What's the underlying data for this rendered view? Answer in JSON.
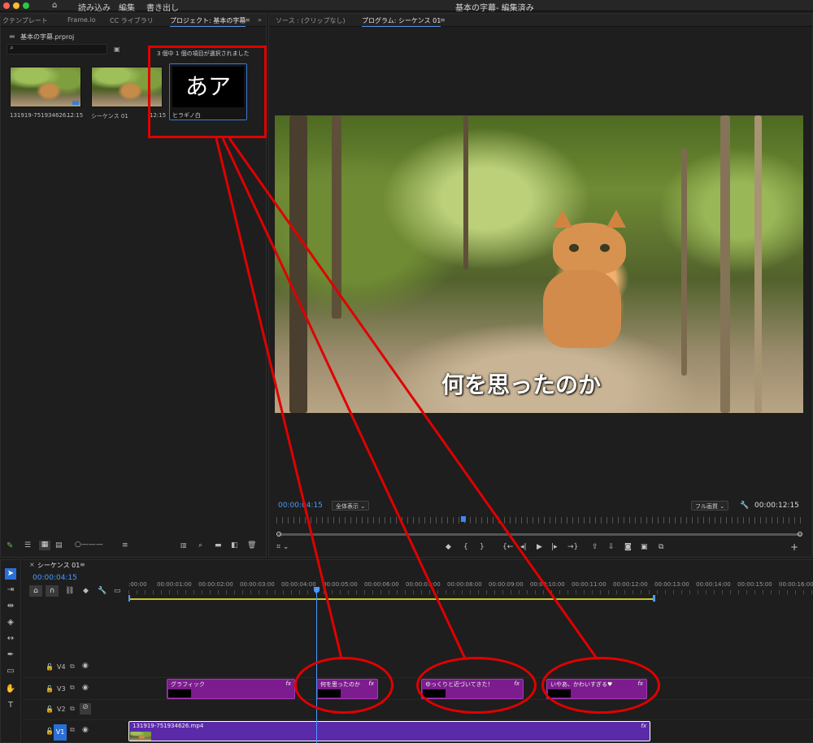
{
  "window": {
    "title": "基本の字幕- 編集済み",
    "menu": {
      "import": "読み込み",
      "edit": "編集",
      "export": "書き出し"
    }
  },
  "project_panel": {
    "tabs": [
      "クテンプレート",
      "Frame.io",
      "CC ライブラリ",
      "プロジェクト: 基本の字幕"
    ],
    "project_file": "基本の字幕.prproj",
    "selection_text": "3 個中 1 個の項目が選択されました",
    "items": [
      {
        "name": "131919-751934626...",
        "duration": "12:15"
      },
      {
        "name": "シーケンス 01",
        "duration": "12:15"
      },
      {
        "name": "ヒラギノ白",
        "preview_text": "あア"
      }
    ]
  },
  "source_tab": "ソース : (クリップなし)",
  "program_tab": "プログラム: シーケンス 01",
  "viewer": {
    "subtitle": "何を思ったのか",
    "current_timecode": "00:00:04:15",
    "fit_label": "全体表示",
    "quality_label": "フル画質",
    "duration": "00:00:12:15"
  },
  "timeline": {
    "tab": "シーケンス 01",
    "timecode": "00:00:04:15",
    "ruler": [
      ":00:00",
      "00:00:01:00",
      "00:00:02:00",
      "00:00:03:00",
      "00:00:04:00",
      "00:00:05:00",
      "00:00:06:00",
      "00:00:07:00",
      "00:00:08:00",
      "00:00:09:00",
      "00:00:10:00",
      "00:00:11:00",
      "00:00:12:00",
      "00:00:13:00",
      "00:00:14:00",
      "00:00:15:00",
      "00:00:16:00"
    ],
    "tracks": [
      "V4",
      "V3",
      "V2",
      "V1"
    ],
    "v3_clips": [
      "グラフィック",
      "何を思ったのか",
      "ゆっくりと近づいてきた！",
      "いやあ、かわいすぎる♥"
    ],
    "v1_clip": "131919-751934626.mp4",
    "fx": "fx"
  },
  "colors": {
    "accent_blue": "#4b9bff",
    "annotation_red": "#e00000",
    "clip_purple": "#7d1c8e"
  }
}
